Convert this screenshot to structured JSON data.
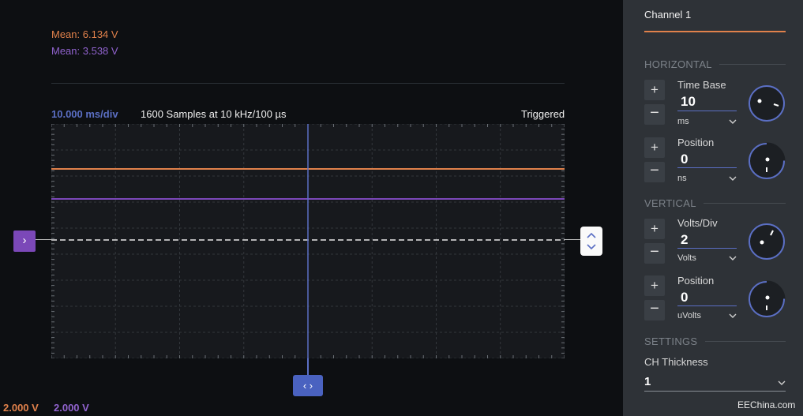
{
  "measurements": {
    "mean1": "Mean: 6.134 V",
    "mean2": "Mean: 3.538 V",
    "mean1_color": "#e0814b",
    "mean2_color": "#9163cf"
  },
  "scope_header": {
    "time_per_div": "10.000 ms/div",
    "samples": "1600 Samples at 10 kHz/100 µs",
    "trigger_status": "Triggered"
  },
  "markers": {
    "channel_marker": "›",
    "time_handle": "‹ ›"
  },
  "bottom_scales": [
    {
      "label": "2.000 V",
      "color": "#e0814b"
    },
    {
      "label": "2.000 V",
      "color": "#9163cf"
    }
  ],
  "panel": {
    "channel_tab": "Channel 1",
    "horizontal": {
      "title": "HORIZONTAL",
      "time_base": {
        "label": "Time Base",
        "value": "10",
        "unit": "ms",
        "knob_icon": "rotary-knob-icon"
      },
      "position": {
        "label": "Position",
        "value": "0",
        "unit": "ns",
        "knob_icon": "rotary-knob-icon"
      }
    },
    "vertical": {
      "title": "VERTICAL",
      "volts_div": {
        "label": "Volts/Div",
        "value": "2",
        "unit": "Volts",
        "knob_icon": "rotary-knob-icon"
      },
      "position": {
        "label": "Position",
        "value": "0",
        "unit": "uVolts",
        "knob_icon": "rotary-knob-icon"
      }
    },
    "settings": {
      "title": "SETTINGS",
      "thickness_label": "CH Thickness",
      "thickness_value": "1"
    },
    "plus": "+",
    "minus": "−"
  },
  "watermark": "EEChina.com",
  "colors": {
    "accent_blue": "#5b6fc4",
    "channel1_orange": "#e0814b",
    "channel2_purple": "#7b48b8"
  }
}
